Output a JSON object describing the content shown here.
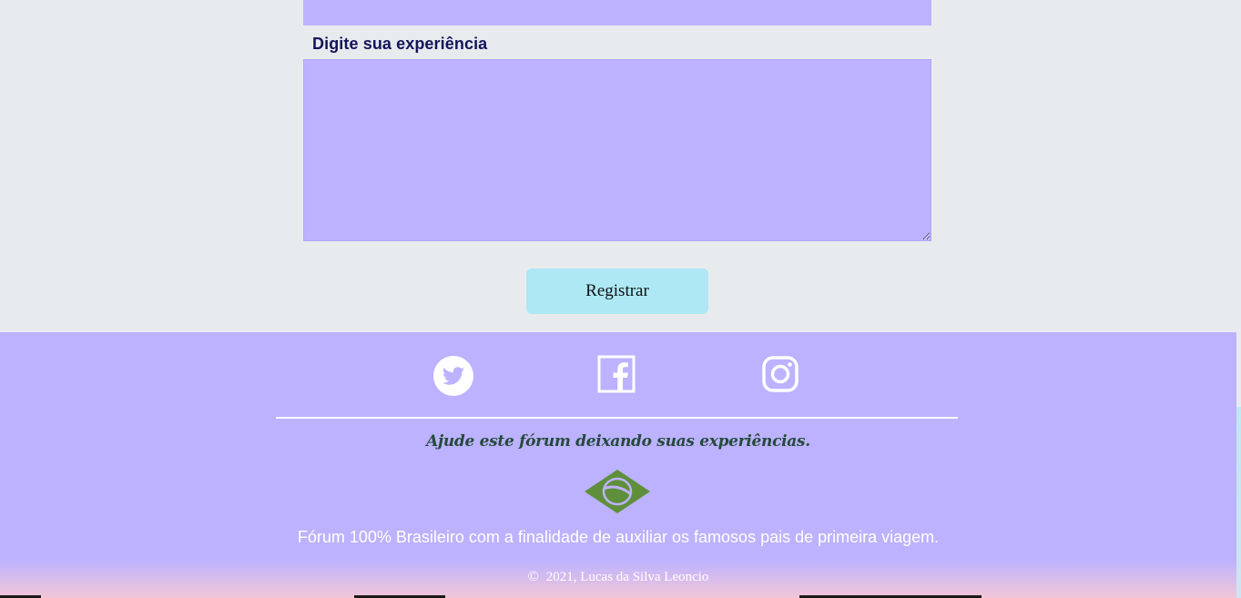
{
  "form": {
    "experience_label": "Digite sua experiência",
    "experience_value": "",
    "submit_label": "Registrar"
  },
  "footer": {
    "social": [
      {
        "name": "twitter",
        "icon": "twitter-icon"
      },
      {
        "name": "facebook",
        "icon": "facebook-icon"
      },
      {
        "name": "instagram",
        "icon": "instagram-icon"
      }
    ],
    "tagline": "Ajude este fórum deixando suas experiências.",
    "logo_icon": "brazil-flag-icon",
    "description": "Fórum 100% Brasileiro com a finalidade de auxiliar os famosos pais de primeira viagem.",
    "copyright_symbol": "©",
    "copyright_text": "2021, Lucas da Silva Leoncio"
  },
  "colors": {
    "page_background": "#e8ebee",
    "field_background": "#bcb2ff",
    "button_background": "#ade8f4",
    "label_color": "#14145a",
    "tagline_color": "#254a3c",
    "logo_green": "#5f8f3a"
  }
}
